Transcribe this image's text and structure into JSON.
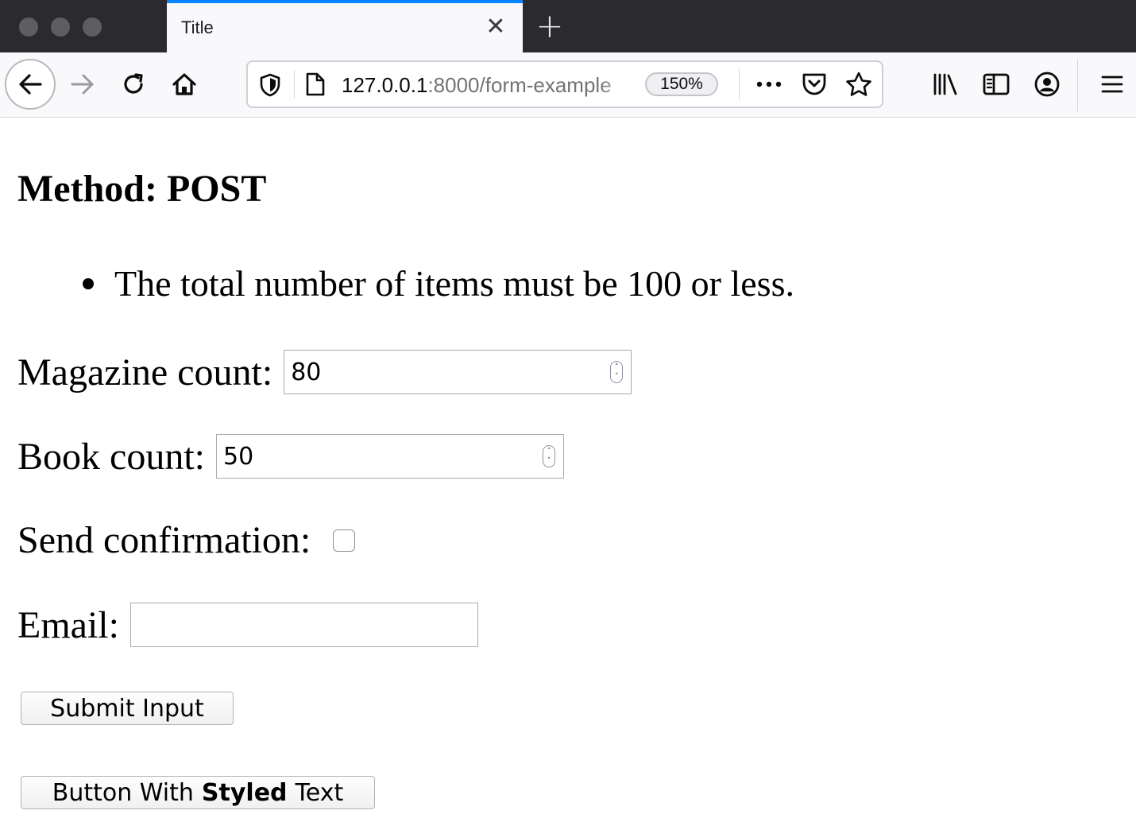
{
  "browser": {
    "tab": {
      "title": "Title",
      "close_icon": "close-icon"
    },
    "new_tab_icon": "plus-icon",
    "nav": {
      "back_icon": "back-arrow-icon",
      "forward_icon": "forward-arrow-icon",
      "reload_icon": "reload-icon",
      "home_icon": "home-icon"
    },
    "urlbar": {
      "host": "127.0.0.1",
      "rest": ":8000/form-example",
      "zoom": "150%",
      "more_icon": "ellipsis-icon",
      "pocket_icon": "pocket-icon",
      "bookmark_icon": "star-icon"
    },
    "toolbar_icons": [
      "library-icon",
      "sidebar-icon",
      "account-icon",
      "hamburger-menu-icon"
    ]
  },
  "page": {
    "method_label": "Method: POST",
    "rules": [
      "The total number of items must be 100 or less."
    ],
    "fields": {
      "magazine": {
        "label": "Magazine count:",
        "value": "80"
      },
      "book": {
        "label": "Book count:",
        "value": "50"
      },
      "confirmation": {
        "label": "Send confirmation:",
        "checked": false
      },
      "email": {
        "label": "Email:",
        "value": ""
      }
    },
    "buttons": {
      "submit_label": "Submit Input",
      "styled": {
        "part1": "Button With",
        "bold": "Styled",
        "part2": "Text"
      }
    }
  },
  "colors": {
    "tabstrip_bg": "#2b2a2e",
    "toolbar_bg": "#f9f9fb",
    "tab_accent": "#0a84ff"
  }
}
